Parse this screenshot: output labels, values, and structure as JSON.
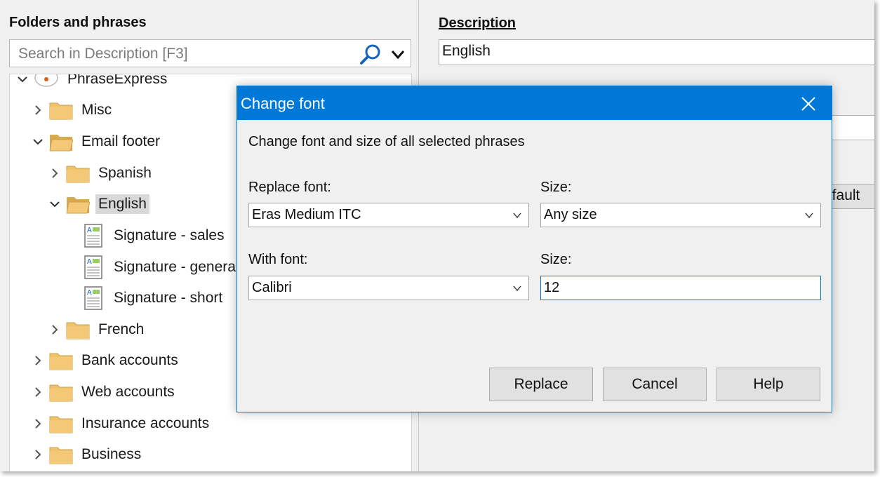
{
  "left_panel": {
    "title": "Folders and phrases",
    "search_placeholder": "Search in Description [F3]",
    "tree": {
      "root": "PhraseExpress",
      "items": [
        {
          "label": "Misc",
          "type": "folder",
          "expanded": false
        },
        {
          "label": "Email footer",
          "type": "folder",
          "expanded": true
        },
        {
          "label": "Spanish",
          "type": "folder",
          "expanded": false
        },
        {
          "label": "English",
          "type": "folder",
          "expanded": true,
          "selected": true
        },
        {
          "label": "Signature - sales",
          "type": "phrase"
        },
        {
          "label": "Signature - genera",
          "type": "phrase"
        },
        {
          "label": "Signature - short",
          "type": "phrase"
        },
        {
          "label": "French",
          "type": "folder",
          "expanded": false
        },
        {
          "label": "Bank accounts",
          "type": "folder",
          "expanded": false
        },
        {
          "label": "Web accounts",
          "type": "folder",
          "expanded": false
        },
        {
          "label": "Insurance accounts",
          "type": "folder",
          "expanded": false
        },
        {
          "label": "Business",
          "type": "folder",
          "expanded": false
        }
      ]
    }
  },
  "right_panel": {
    "description_label": "Description",
    "description_value": "English",
    "default_button_partial": "efault"
  },
  "dialog": {
    "title": "Change font",
    "intro": "Change font and size of all selected phrases",
    "replace_font_label": "Replace font:",
    "replace_font_value": "Eras Medium ITC",
    "size_label_1": "Size:",
    "size_value_1": "Any size",
    "with_font_label": "With font:",
    "with_font_value": "Calibri",
    "size_label_2": "Size:",
    "size_value_2": "12",
    "buttons": {
      "replace": "Replace",
      "cancel": "Cancel",
      "help": "Help"
    }
  },
  "colors": {
    "accent": "#0078d7",
    "folder": "#f0c36b",
    "selection": "#d9d9d9"
  },
  "icons": [
    "search-icon",
    "chevron-down-icon",
    "chevron-right-icon",
    "folder-icon",
    "document-icon",
    "close-icon",
    "app-logo-icon"
  ]
}
